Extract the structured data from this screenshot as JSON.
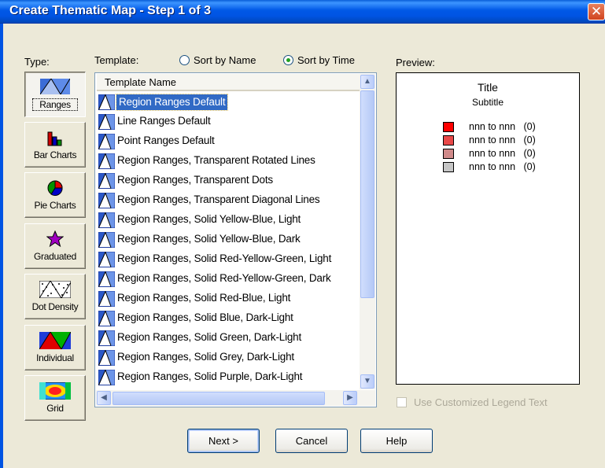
{
  "window": {
    "title": "Create Thematic Map - Step 1 of 3",
    "close_glyph": "✕"
  },
  "type_label": "Type:",
  "template_label": "Template:",
  "sort": {
    "by_name": "Sort by Name",
    "by_time": "Sort by Time",
    "selected": "by_time"
  },
  "types": [
    {
      "label": "Ranges",
      "icon": "ranges-icon",
      "pressed": true
    },
    {
      "label": "Bar Charts",
      "icon": "bar-charts-icon",
      "pressed": false
    },
    {
      "label": "Pie Charts",
      "icon": "pie-charts-icon",
      "pressed": false
    },
    {
      "label": "Graduated",
      "icon": "graduated-icon",
      "pressed": false
    },
    {
      "label": "Dot Density",
      "icon": "dot-density-icon",
      "pressed": false
    },
    {
      "label": "Individual",
      "icon": "individual-icon",
      "pressed": false
    },
    {
      "label": "Grid",
      "icon": "grid-icon",
      "pressed": false
    }
  ],
  "list": {
    "header": "Template Name",
    "selected_index": 0,
    "items": [
      "Region Ranges Default",
      "Line Ranges Default",
      "Point Ranges Default",
      "Region Ranges, Transparent Rotated Lines",
      "Region Ranges, Transparent Dots",
      "Region Ranges, Transparent Diagonal Lines",
      "Region Ranges, Solid Yellow-Blue, Light",
      "Region Ranges, Solid Yellow-Blue, Dark",
      "Region Ranges, Solid Red-Yellow-Green, Light",
      "Region Ranges, Solid Red-Yellow-Green, Dark",
      "Region Ranges, Solid Red-Blue, Light",
      "Region Ranges, Solid Blue, Dark-Light",
      "Region Ranges, Solid Green, Dark-Light",
      "Region Ranges, Solid Grey, Dark-Light",
      "Region Ranges, Solid Purple, Dark-Light"
    ]
  },
  "preview": {
    "label": "Preview:",
    "title": "Title",
    "subtitle": "Subtitle",
    "legend": [
      {
        "color": "#FF0000",
        "text": "nnn to nnn   (0)"
      },
      {
        "color": "#E84848",
        "text": "nnn to nnn   (0)"
      },
      {
        "color": "#D08A8A",
        "text": "nnn to nnn   (0)"
      },
      {
        "color": "#C6C6C6",
        "text": "nnn to nnn   (0)"
      }
    ]
  },
  "custom_legend": {
    "label": "Use Customized Legend Text",
    "checked": false,
    "enabled": false
  },
  "buttons": {
    "next": "Next >",
    "cancel": "Cancel",
    "help": "Help"
  }
}
